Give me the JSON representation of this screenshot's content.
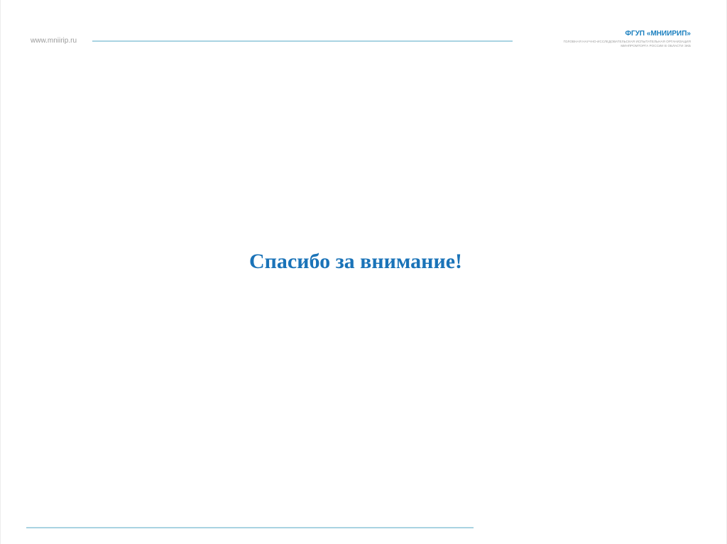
{
  "header": {
    "site_url": "www.mniirip.ru",
    "org_name": "ФГУП «МНИИРИП»",
    "org_desc_line1": "ГОЛОВНАЯ НАУЧНО-ИССЛЕДОВАТЕЛЬСКАЯ ИСПЫТАТЕЛЬНАЯ ОРГАНИЗАЦИЯ",
    "org_desc_line2": "МИНПРОМТОРГА РОССИИ В ОБЛАСТИ ЭКБ"
  },
  "main": {
    "thanks_text": "Спасибо за внимание!"
  },
  "colors": {
    "accent": "#1a73b8",
    "rule": "#a9d3e2",
    "muted_text": "#9a9a9a"
  }
}
